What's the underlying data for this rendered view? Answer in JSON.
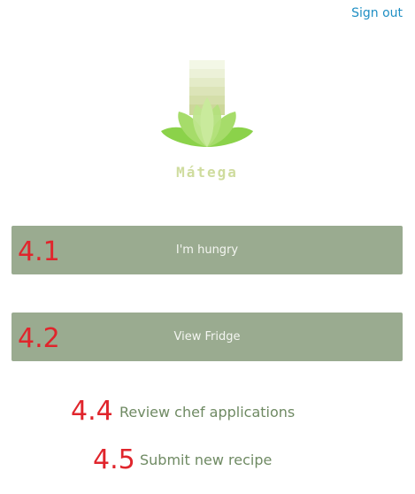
{
  "header": {
    "signout_label": "Sign out"
  },
  "logo": {
    "text": "Mátega",
    "icon": "lotus-logo-icon"
  },
  "buttons": {
    "hungry_label": "I'm hungry",
    "fridge_label": "View Fridge"
  },
  "links": {
    "review_label": "Review chef applications",
    "submit_label": "Submit new recipe"
  },
  "annotations": {
    "a41": "4.1",
    "a42": "4.2",
    "a44": "4.4",
    "a45": "4.5"
  },
  "colors": {
    "link_blue": "#1f8fc4",
    "button_bg": "#9aab90",
    "annotation_red": "#e0252c",
    "link_green": "#6f8a63"
  }
}
